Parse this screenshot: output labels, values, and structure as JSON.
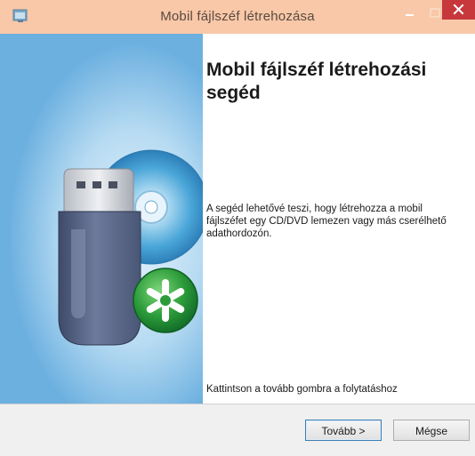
{
  "window": {
    "title": "Mobil fájlszéf létrehozása"
  },
  "main": {
    "heading": "Mobil fájlszéf létrehozási segéd",
    "description": "A segéd lehetővé teszi, hogy létrehozza a mobil fájlszéfet egy CD/DVD lemezen vagy más cserélhető adathordozón.",
    "hint": "Kattintson a tovább gombra a folytatáshoz"
  },
  "footer": {
    "next_label": "Tovább >",
    "cancel_label": "Mégse"
  },
  "colors": {
    "titlebar": "#f8c8a8",
    "close_button": "#c7383c",
    "banner_blue": "#6cb0e0",
    "badge_green": "#2c9c3a"
  },
  "icons": {
    "app": "app-window-icon",
    "minimize": "minimize-icon",
    "maximize": "maximize-icon",
    "close": "close-icon",
    "illustration": "usb-drive-disc-badge"
  }
}
